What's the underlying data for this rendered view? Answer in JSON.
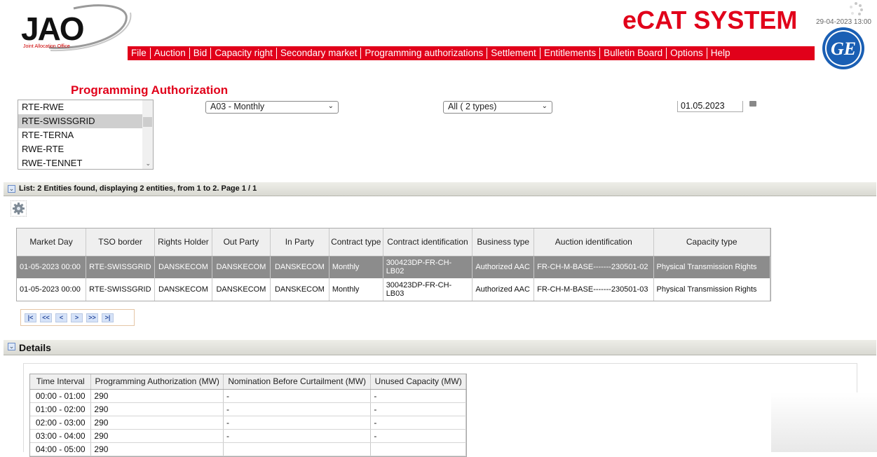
{
  "header": {
    "logo_text": "JAO",
    "logo_subtitle": "Joint Allocation Office",
    "system_title": "eCAT SYSTEM",
    "datetime": "29-04-2023 13:00",
    "ge_logo_text": "GE"
  },
  "nav": {
    "items": [
      "File",
      "Auction",
      "Bid",
      "Capacity right",
      "Secondary market",
      "Programming authorizations",
      "Settlement",
      "Entitlements",
      "Bulletin Board",
      "Options",
      "Help"
    ]
  },
  "page_title": "Programming Authorization",
  "filters": {
    "borders": [
      "RTE-RWE",
      "RTE-SWISSGRID",
      "RTE-TERNA",
      "RWE-RTE",
      "RWE-TENNET"
    ],
    "selected_border": "RTE-SWISSGRID",
    "period_select": "A03 - Monthly",
    "type_select": "All ( 2 types)",
    "date_value": "01.05.2023"
  },
  "list_section": {
    "status": "List: 2 Entities found, displaying 2 entities, from 1 to 2. Page 1 / 1",
    "columns": [
      "Market Day",
      "TSO border",
      "Rights Holder",
      "Out Party",
      "In Party",
      "Contract type",
      "Contract identification",
      "Business type",
      "Auction identification",
      "Capacity type"
    ],
    "rows": [
      [
        "01-05-2023 00:00",
        "RTE-SWISSGRID",
        "DANSKECOM",
        "DANSKECOM",
        "DANSKECOM",
        "Monthly",
        "300423DP-FR-CH-LB02",
        "Authorized AAC",
        "FR-CH-M-BASE-------230501-02",
        "Physical Transmission Rights"
      ],
      [
        "01-05-2023 00:00",
        "RTE-SWISSGRID",
        "DANSKECOM",
        "DANSKECOM",
        "DANSKECOM",
        "Monthly",
        "300423DP-FR-CH-LB03",
        "Authorized AAC",
        "FR-CH-M-BASE-------230501-03",
        "Physical Transmission Rights"
      ]
    ],
    "selected_row": 0,
    "pager": [
      "|<",
      "<<",
      "<",
      ">",
      ">>",
      ">|"
    ]
  },
  "details_section": {
    "title": "Details",
    "columns": [
      "Time Interval",
      "Programming Authorization (MW)",
      "Nomination Before Curtailment (MW)",
      "Unused Capacity (MW)"
    ],
    "rows": [
      [
        "00:00 - 01:00",
        "290",
        "-",
        "-"
      ],
      [
        "01:00 - 02:00",
        "290",
        "-",
        "-"
      ],
      [
        "02:00 - 03:00",
        "290",
        "-",
        "-"
      ],
      [
        "03:00 - 04:00",
        "290",
        "-",
        "-"
      ],
      [
        "04:00 - 05:00",
        "290",
        "",
        ""
      ]
    ]
  },
  "colors": {
    "accent_red": "#e1001a",
    "selected_row": "#8c8c8c"
  }
}
